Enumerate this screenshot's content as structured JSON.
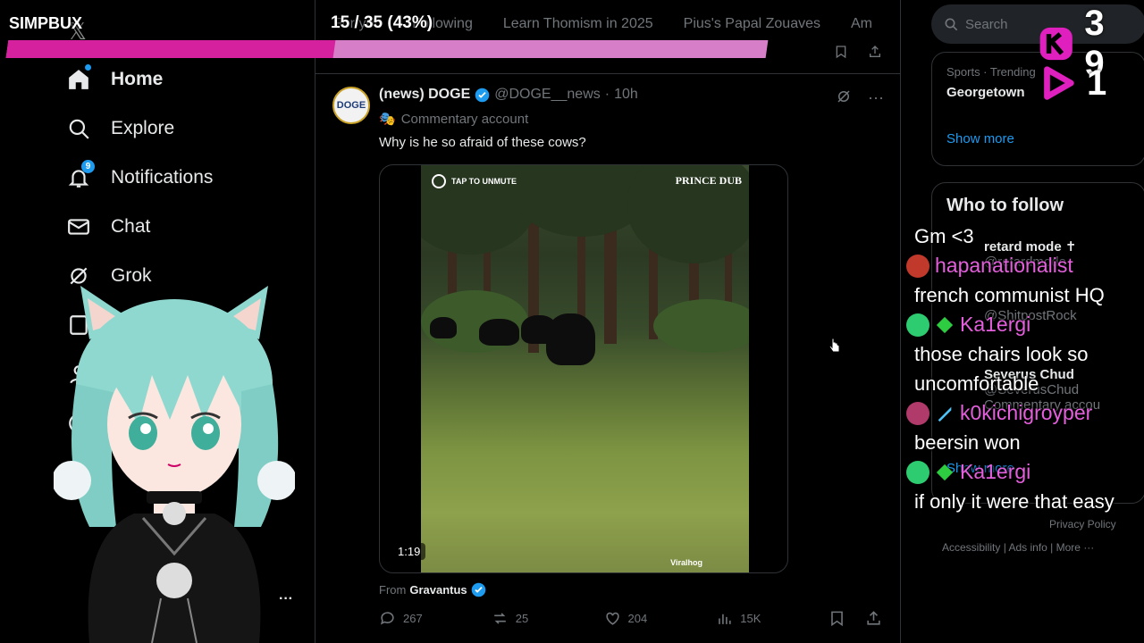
{
  "overlay": {
    "currency_label": "SIMPBUX",
    "progress_text": "15 / 35 (43%)",
    "progress_fraction": 0.43,
    "counter_k": "3 9",
    "counter_play": "1"
  },
  "nav": {
    "items": [
      {
        "label": "Home",
        "icon": "home-icon"
      },
      {
        "label": "Explore",
        "icon": "search-icon"
      },
      {
        "label": "Notifications",
        "icon": "bell-icon",
        "badge": "9"
      },
      {
        "label": "Chat",
        "icon": "mail-icon"
      },
      {
        "label": "Grok",
        "icon": "grok-icon"
      }
    ]
  },
  "feed": {
    "tabs": [
      "For you",
      "Following",
      "Learn Thomism in 2025",
      "Pius's Papal Zouaves",
      "Am"
    ],
    "post": {
      "avatar_text": "DOGE",
      "author_name": "(news) DOGE",
      "handle": "@DOGE__news",
      "time": "10h",
      "commentary": "Commentary account",
      "text": "Why is he so afraid of these cows?",
      "video": {
        "top_label": "TAP TO UNMUTE",
        "logo": "PRINCE DUB",
        "duration": "1:19",
        "watermark": "Viralhog"
      },
      "from_prefix": "From",
      "from_name": "Gravantus",
      "replies": "267",
      "reposts": "25",
      "likes": "204",
      "views": "15K"
    }
  },
  "right": {
    "search_placeholder": "Search",
    "trend": {
      "meta": "Sports · Trending",
      "name": "Georgetown",
      "show_more": "Show more"
    },
    "follow": {
      "title": "Who to follow",
      "users": [
        {
          "name": "retard mode ✝",
          "handle": "@retardmode"
        },
        {
          "name": "",
          "handle": "@ShitpostRock"
        },
        {
          "name": "Severus Chud",
          "handle": "@SeverusChud"
        }
      ],
      "commentary": "Commentary accou",
      "show_more": "Show more"
    },
    "footer": [
      "Privacy Policy",
      "Accessibility",
      "Ads info",
      "More ···"
    ]
  },
  "chat": [
    {
      "type": "msg",
      "text": "Gm <3"
    },
    {
      "type": "user",
      "name": "hapanationalist",
      "avatar_color": "#c0392b",
      "badge": ""
    },
    {
      "type": "msg",
      "text": "french communist HQ"
    },
    {
      "type": "user",
      "name": "Ka1ergi",
      "avatar_color": "#2ecc71",
      "badge": "green-diamond-icon"
    },
    {
      "type": "msg",
      "text": "those chairs look so uncomfortable"
    },
    {
      "type": "user",
      "name": "k0kichigroyper",
      "avatar_color": "#b03a6a",
      "badge": "sword-icon"
    },
    {
      "type": "msg",
      "text": "beersin won"
    },
    {
      "type": "user",
      "name": "Ka1ergi",
      "avatar_color": "#2ecc71",
      "badge": "green-diamond-icon"
    },
    {
      "type": "msg",
      "text": "if only it were that easy"
    }
  ],
  "colors": {
    "accent": "#1d9bf0",
    "overlay_pink": "#d6219f",
    "chat_name": "#e45fdc"
  }
}
